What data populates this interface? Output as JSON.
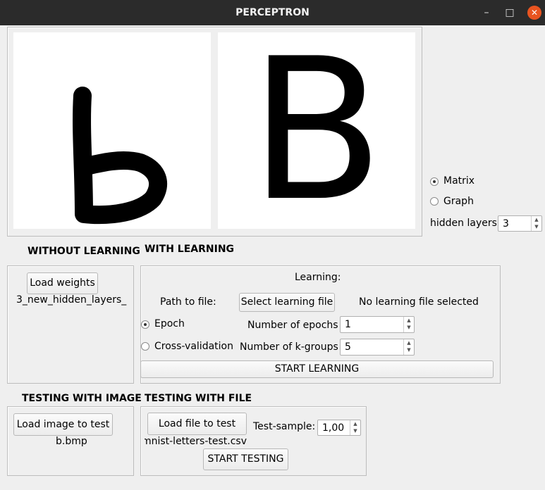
{
  "window": {
    "title": "PERCEPTRON"
  },
  "view_mode": {
    "options": [
      {
        "label": "Matrix",
        "selected": true
      },
      {
        "label": "Graph",
        "selected": false
      }
    ]
  },
  "hidden_layers": {
    "label": "hidden layers",
    "value": "3"
  },
  "recognized_letter": "B",
  "without_learning": {
    "heading": "WITHOUT LEARNING",
    "load_weights_label": "Load weights",
    "weights_file": "3_new_hidden_layers_"
  },
  "with_learning": {
    "heading": "WITH LEARNING",
    "panel_title": "Learning:",
    "path_label": "Path to file:",
    "select_file_label": "Select learning file",
    "file_status": "No learning file selected",
    "mode_options": [
      {
        "label": "Epoch",
        "selected": true
      },
      {
        "label": "Cross-validation",
        "selected": false
      }
    ],
    "epochs_label": "Number of epochs",
    "epochs_value": "1",
    "kgroups_label": "Number of k-groups",
    "kgroups_value": "5",
    "start_label": "START LEARNING"
  },
  "testing_image": {
    "heading": "TESTING WITH IMAGE",
    "load_label": "Load image to test",
    "file_name": "b.bmp"
  },
  "testing_file": {
    "heading": "TESTING WITH FILE",
    "load_label": "Load file to test",
    "file_name": "emnist-letters-test.csv",
    "sample_label": "Test-sample:",
    "sample_value": "1,00",
    "start_label": "START TESTING"
  }
}
